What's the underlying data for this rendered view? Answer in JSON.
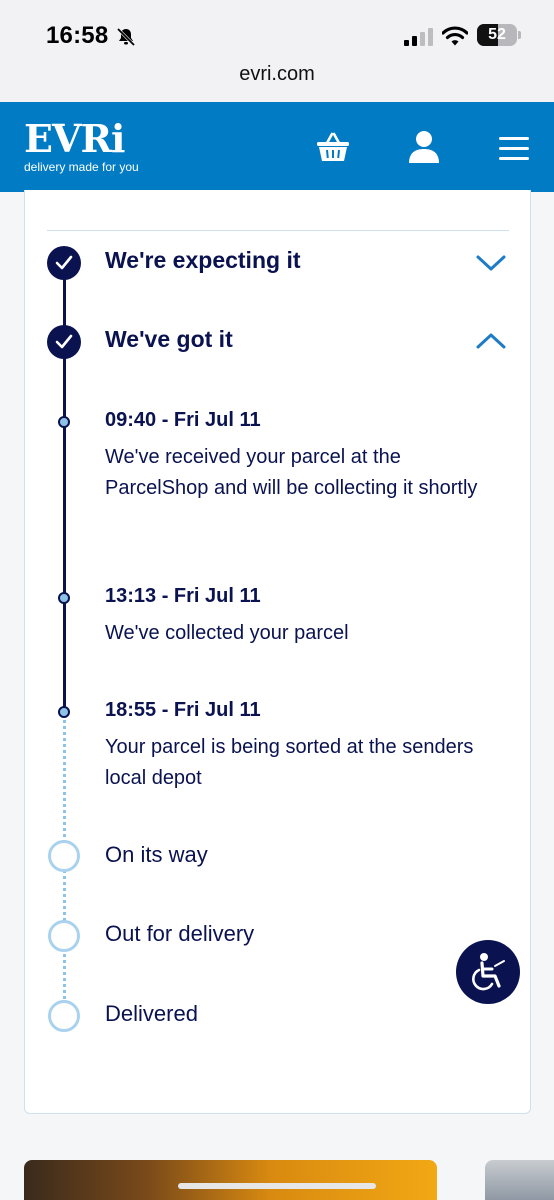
{
  "status_bar": {
    "time": "16:58",
    "battery": "52"
  },
  "browser": {
    "url": "evri.com"
  },
  "header": {
    "logo": "EVRi",
    "tagline": "delivery made for you",
    "icons": [
      "basket-icon",
      "account-icon",
      "menu-icon"
    ],
    "brand_color": "#007bc4"
  },
  "tracking": {
    "stages": [
      {
        "label": "We're expecting it",
        "status": "complete",
        "expanded": false
      },
      {
        "label": "We've got it",
        "status": "complete",
        "expanded": true
      },
      {
        "label": "On its way",
        "status": "pending"
      },
      {
        "label": "Out for delivery",
        "status": "pending"
      },
      {
        "label": "Delivered",
        "status": "pending"
      }
    ],
    "events": [
      {
        "time": "09:40 - Fri Jul 11",
        "desc": "We've received your parcel at the ParcelShop and will be collecting it shortly"
      },
      {
        "time": "13:13 - Fri Jul 11",
        "desc": "We've collected your parcel"
      },
      {
        "time": "18:55 - Fri Jul 11",
        "desc": "Your parcel is being sorted at the senders local depot"
      }
    ],
    "colors": {
      "complete": "#0a1250",
      "pending": "#a9d2ee",
      "accent": "#007bc4"
    }
  }
}
